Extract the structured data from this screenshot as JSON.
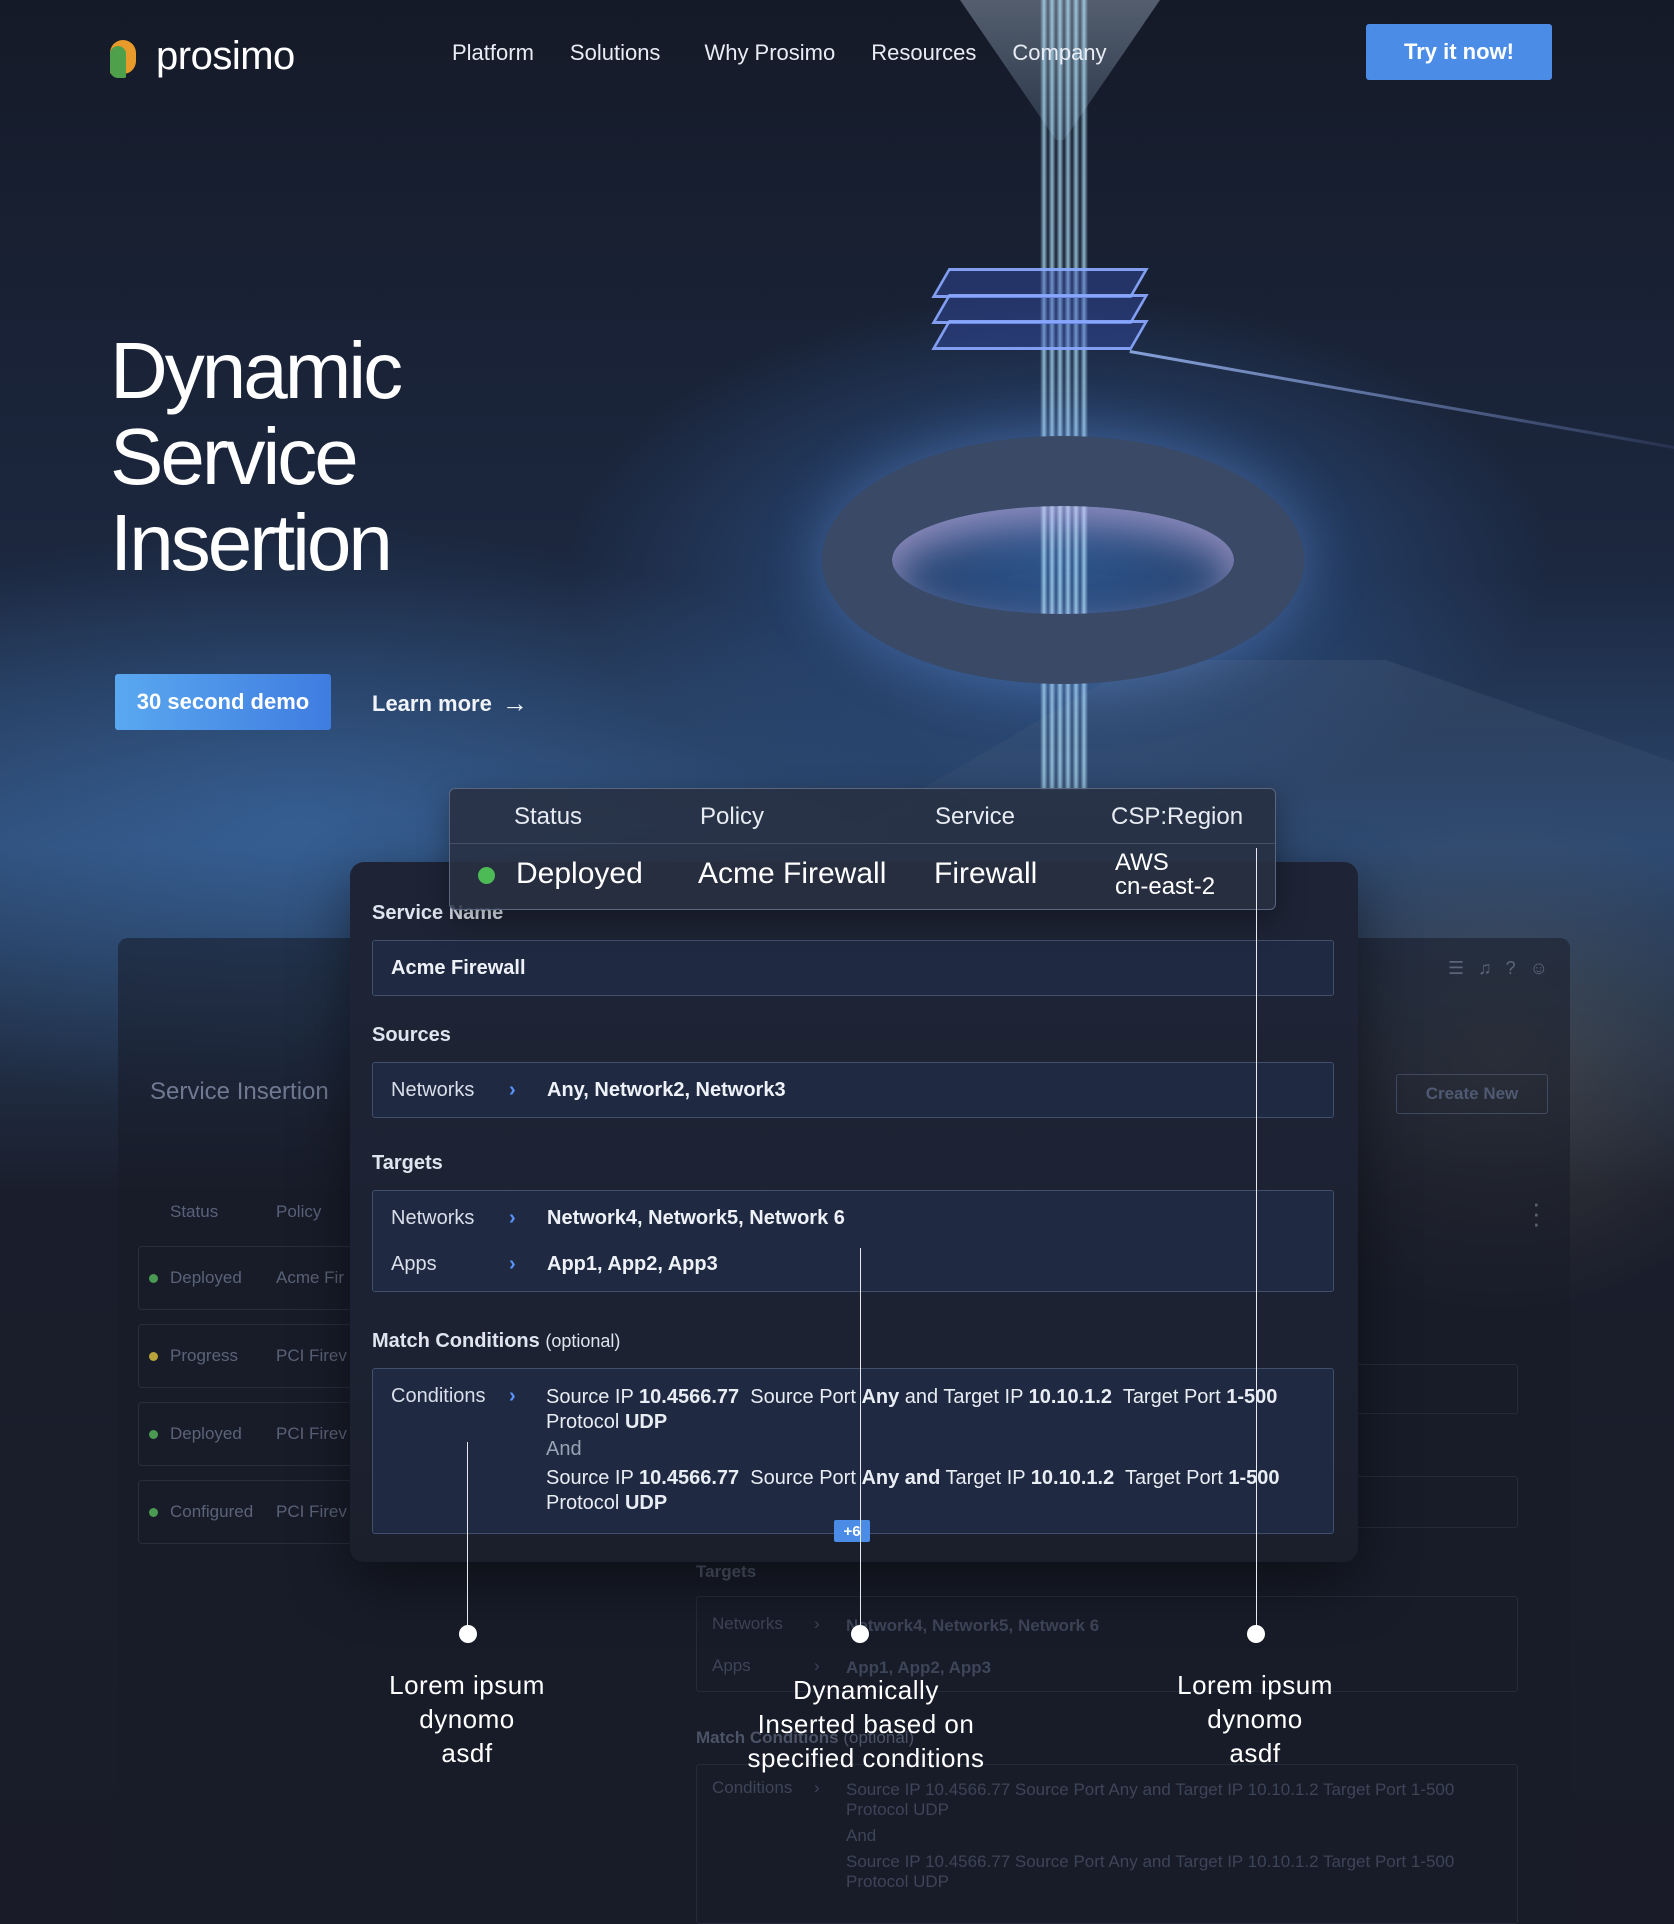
{
  "nav": {
    "brand": "prosimo",
    "links": [
      "Platform",
      "Solutions",
      "Why Prosimo",
      "Resources",
      "Company"
    ],
    "cta": "Try it now!"
  },
  "hero": {
    "title_lines": [
      "Dynamic",
      "Service",
      "Insertion"
    ],
    "demo_button": "30 second demo",
    "learn_more": "Learn more"
  },
  "status_table": {
    "headers": [
      "Status",
      "Policy",
      "Service",
      "CSP:Region"
    ],
    "row": {
      "status": "Deployed",
      "policy": "Acme Firewall",
      "service": "Firewall",
      "region_line1": "AWS",
      "region_line2": "cn-east-2"
    },
    "status_color": "#4dbb55"
  },
  "card": {
    "service_name_label": "Service Name",
    "service_name_value": "Acme Firewall",
    "sources_label": "Sources",
    "sources": {
      "key": "Networks",
      "value": "Any, Network2, Network3"
    },
    "targets_label": "Targets",
    "targets": [
      {
        "key": "Networks",
        "value": "Network4, Network5, Network 6"
      },
      {
        "key": "Apps",
        "value": "App1, App2, App3"
      }
    ],
    "match_label": "Match Conditions",
    "match_optional": "(optional)",
    "conditions_key": "Conditions",
    "condition_1": {
      "src_ip_label": "Source IP",
      "src_ip": "10.4566.77",
      "src_port_label": "Source Port",
      "src_port": "Any",
      "and_label": "and",
      "tgt_ip_label": "Target IP",
      "tgt_ip": "10.10.1.2",
      "tgt_port_label": "Target Port",
      "tgt_port": "1-500",
      "proto_label": "Protocol",
      "proto": "UDP"
    },
    "and_separator": "And",
    "condition_2": {
      "src_ip_label": "Source IP",
      "src_ip": "10.4566.77",
      "src_port_label": "Source Port",
      "src_port": "Any and",
      "tgt_ip_label": "Target IP",
      "tgt_ip": "10.10.1.2",
      "tgt_port_label": "Target Port",
      "tgt_port": "1-500",
      "proto_label": "Protocol",
      "proto": "UDP"
    },
    "more_badge": "+6"
  },
  "background_dashboard": {
    "title": "Service Insertion",
    "create_button": "Create New",
    "headers": [
      "Status",
      "Policy"
    ],
    "rows": [
      {
        "status": "Deployed",
        "policy": "Acme Fir",
        "color": "#4a9a52"
      },
      {
        "status": "Progress",
        "policy": "PCI Firev",
        "color": "#b8a23a"
      },
      {
        "status": "Deployed",
        "policy": "PCI Firev",
        "color": "#4a9a52"
      },
      {
        "status": "Configured",
        "policy": "PCI Firev",
        "color": "#4a9a52"
      }
    ],
    "targets_label": "Targets",
    "targets": [
      {
        "key": "Networks",
        "value": "Network4, Network5, Network 6"
      },
      {
        "key": "Apps",
        "value": "App1, App2, App3"
      }
    ],
    "match_label": "Match Conditions",
    "match_optional": "(optional)",
    "conditions_key": "Conditions",
    "cond_line_1": "Source IP 10.4566.77  Source Port Any and Target IP 10.10.1.2  Target Port 1-500",
    "cond_line_2": "Protocol UDP",
    "cond_and": "And",
    "cond_line_3": "Source IP 10.4566.77  Source Port Any and Target IP 10.10.1.2  Target Port 1-500",
    "cond_line_4": "Protocol UDP"
  },
  "callouts": {
    "left": [
      "Lorem ipsum",
      "dynomo",
      "asdf"
    ],
    "middle": [
      "Dynamically",
      "Inserted based on",
      "specified conditions"
    ],
    "right": [
      "Lorem ipsum",
      "dynomo",
      "asdf"
    ]
  },
  "icons": [
    "logo-mark-icon",
    "arrow-right-icon",
    "chevron-right-icon",
    "list-icon",
    "bell-icon",
    "help-icon",
    "user-icon",
    "kebab-menu-icon"
  ],
  "colors": {
    "accent": "#4a8ce6",
    "background": "#1a1d29",
    "chevron": "#5b95ff"
  }
}
